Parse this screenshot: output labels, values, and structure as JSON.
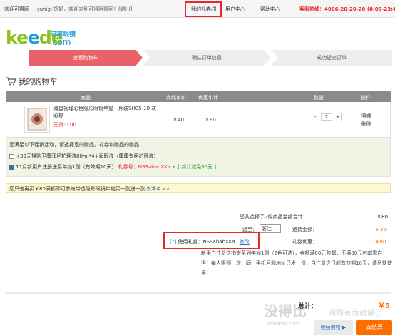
{
  "topbar": {
    "welcome": "欢迎可得网",
    "user": "sunigj 您好，欢迎来到可得眼镜网！[退出]",
    "gift": "我的礼券/礼卡",
    "center": "用户中心",
    "help": "帮助中心",
    "hotline": "客服热线：4006-20-20-20 (8:00-23:45)"
  },
  "logo": {
    "ke": "ke",
    "e": "e",
    "de": "de",
    "cn": "可得眼镜",
    "com": ".com"
  },
  "steps": [
    "查看购物车",
    "确认订单信息",
    "成功提交订单"
  ],
  "cart_title": "我的购物车",
  "table": {
    "headers": [
      "商品",
      "商城单价",
      "优惠小计",
      "数量",
      "操作"
    ]
  },
  "product": {
    "name": "海昌视瑾彩色隐形眼镜年抛一片装SH05-18 灰彩棕",
    "stock": "无货:0.00",
    "price": "￥40",
    "subtotal": "￥80",
    "qty": "2",
    "minus": "-",
    "plus": "+",
    "fav": "收藏",
    "del": "删除"
  },
  "promo": {
    "title": "您满足以下促销活动，请选择您的赠品，礼券和赠品的赠品",
    "item1": "+39元换购卫康菲尼护理液80ml*4+润眼液（康康专用护理液）",
    "item2a": "11月新用户注册送系年抛1副（有效期10天）",
    "item2b": "礼券号：NSSababXKa",
    "item2c": "[ 共计减免80元 ]"
  },
  "notice": {
    "text": "您只差再买￥80满额即可参与带透隐形眼镜年抛买一副送一副",
    "link": "去凑单>>"
  },
  "summary": {
    "count_a": "您共选择了",
    "count_n": "2",
    "count_b": "件商品金额合计：",
    "count_v": "￥80",
    "ship_label": "运至：",
    "ship_value": "浙江",
    "ship_fee_label": "运费金额：",
    "ship_fee": "+￥5",
    "coupon_q": "[?]",
    "coupon_label": "使用礼券：NSSababXKa",
    "coupon_edit": "修改",
    "coupon_disc_label": "礼券优惠：",
    "coupon_disc": "-￥80",
    "desc": "新用户注册送指定系列年抛1副（5色可选），金额满80元包邮，不满80元包邮需自担！每人限领一次，同一手机号和地址只发一份，自注册之日起有效期10天，请尽快使用！",
    "total_label": "总计：",
    "total": "￥5",
    "continue": "继续购物",
    "checkout": "去结算"
  },
  "watermark": {
    "a": "没得比",
    "b": "网购有我就够了",
    "c": "Meidebi.com"
  }
}
